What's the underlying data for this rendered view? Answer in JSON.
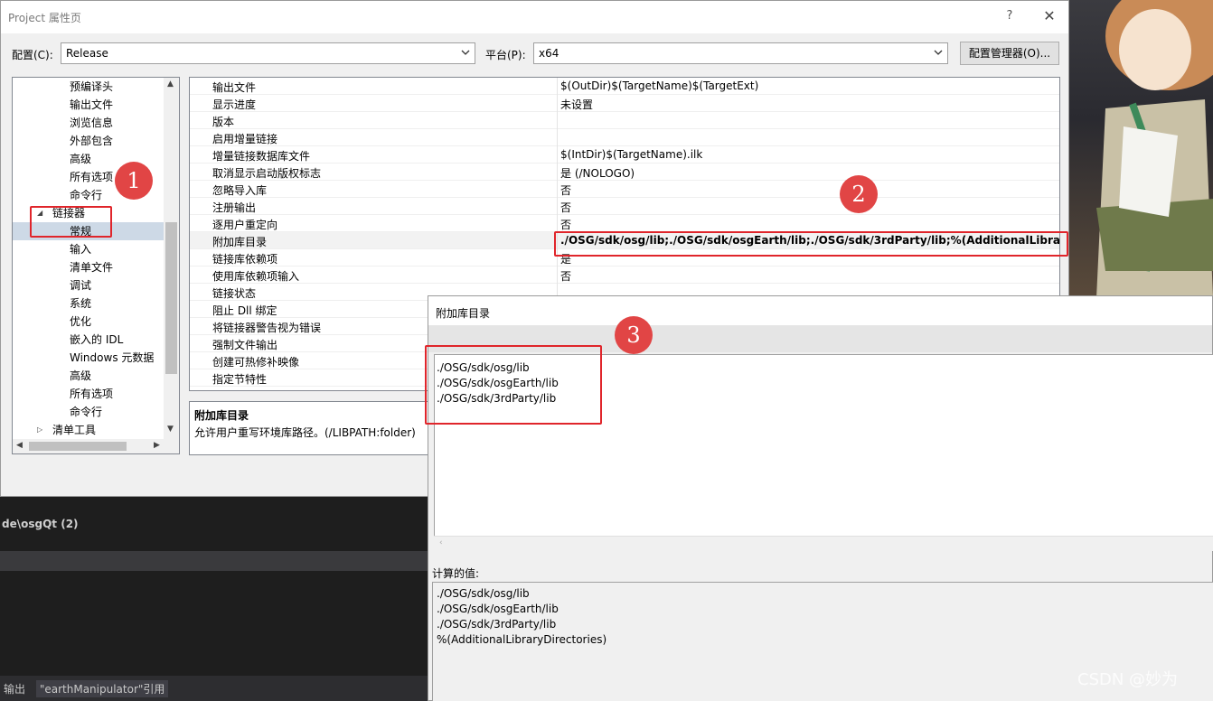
{
  "background": {
    "editor_tab": "de\\osgQt  (2)",
    "bottom_tabs": [
      "输出",
      "\"earthManipulator\"引用"
    ],
    "watermark": "CSDN @妙为"
  },
  "dialog": {
    "title": "Project 属性页",
    "help": "?",
    "close": "✕",
    "config_label": "配置(C):",
    "config_value": "Release",
    "platform_label": "平台(P):",
    "platform_value": "x64",
    "config_manager_button": "配置管理器(O)..."
  },
  "tree": {
    "items": [
      {
        "label": "预编译头",
        "indent": 2
      },
      {
        "label": "输出文件",
        "indent": 2
      },
      {
        "label": "浏览信息",
        "indent": 2
      },
      {
        "label": "外部包含",
        "indent": 2
      },
      {
        "label": "高级",
        "indent": 2
      },
      {
        "label": "所有选项",
        "indent": 2
      },
      {
        "label": "命令行",
        "indent": 2
      },
      {
        "label": "链接器",
        "indent": 1,
        "expander": "◢"
      },
      {
        "label": "常规",
        "indent": 2,
        "selected": true
      },
      {
        "label": "输入",
        "indent": 2
      },
      {
        "label": "清单文件",
        "indent": 2
      },
      {
        "label": "调试",
        "indent": 2
      },
      {
        "label": "系统",
        "indent": 2
      },
      {
        "label": "优化",
        "indent": 2
      },
      {
        "label": "嵌入的 IDL",
        "indent": 2
      },
      {
        "label": "Windows 元数据",
        "indent": 2
      },
      {
        "label": "高级",
        "indent": 2
      },
      {
        "label": "所有选项",
        "indent": 2
      },
      {
        "label": "命令行",
        "indent": 2
      },
      {
        "label": "清单工具",
        "indent": 1,
        "expander": "▷"
      }
    ]
  },
  "properties": {
    "rows": [
      {
        "name": "输出文件",
        "value": "$(OutDir)$(TargetName)$(TargetExt)"
      },
      {
        "name": "显示进度",
        "value": "未设置"
      },
      {
        "name": "版本",
        "value": ""
      },
      {
        "name": "启用增量链接",
        "value": ""
      },
      {
        "name": "增量链接数据库文件",
        "value": "$(IntDir)$(TargetName).ilk"
      },
      {
        "name": "取消显示启动版权标志",
        "value": "是 (/NOLOGO)"
      },
      {
        "name": "忽略导入库",
        "value": "否"
      },
      {
        "name": "注册输出",
        "value": "否"
      },
      {
        "name": "逐用户重定向",
        "value": "否"
      },
      {
        "name": "附加库目录",
        "value": "./OSG/sdk/osg/lib;./OSG/sdk/osgEarth/lib;./OSG/sdk/3rdParty/lib;%(AdditionalLibraryDire",
        "bold": true
      },
      {
        "name": "链接库依赖项",
        "value": "是"
      },
      {
        "name": "使用库依赖项输入",
        "value": "否"
      },
      {
        "name": "链接状态",
        "value": ""
      },
      {
        "name": "阻止 Dll 绑定",
        "value": ""
      },
      {
        "name": "将链接器警告视为错误",
        "value": ""
      },
      {
        "name": "强制文件输出",
        "value": ""
      },
      {
        "name": "创建可热修补映像",
        "value": ""
      },
      {
        "name": "指定节特性",
        "value": ""
      }
    ],
    "description_title": "附加库目录",
    "description_text": "允许用户重写环境库路径。(/LIBPATH:folder)"
  },
  "markers": [
    "1",
    "2",
    "3"
  ],
  "subdialog": {
    "title": "附加库目录",
    "list": [
      "./OSG/sdk/osg/lib",
      "./OSG/sdk/osgEarth/lib",
      "./OSG/sdk/3rdParty/lib"
    ],
    "computed_label": "计算的值:",
    "computed": [
      "./OSG/sdk/osg/lib",
      "./OSG/sdk/osgEarth/lib",
      "./OSG/sdk/3rdParty/lib",
      "%(AdditionalLibraryDirectories)"
    ]
  },
  "colors": {
    "annotation_red": "#e0252b",
    "marker_fill": "#e14545",
    "selection": "#cdd9e6"
  }
}
